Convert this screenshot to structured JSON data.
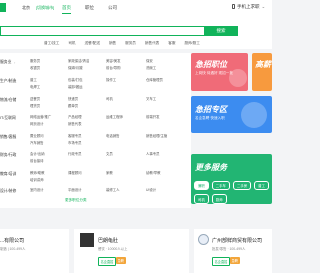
{
  "header": {
    "city": "北京",
    "switch_label": "[切换城市]",
    "nav": [
      "首页",
      "职位",
      "公司"
    ],
    "phone_label": "手机上求职"
  },
  "search": {
    "placeholder": "",
    "button_label": "搜索",
    "hot_tags": [
      "普工/技工",
      "司机",
      "送餐/配送",
      "销售",
      "服务员",
      "销售代表",
      "客服",
      "厨师/厨工"
    ]
  },
  "categories": {
    "rows": [
      {
        "label": "服务业",
        "items": [
          "服务员",
          "家政保洁/清洁",
          "美容/美发",
          "保安",
          "收银员",
          "保姆/月嫂",
          "前台/导购",
          "洗碗工"
        ]
      },
      {
        "label": "生产/制造",
        "items": [
          "普工",
          "包装/打包",
          "操作工",
          "仓库管理员",
          "电焊工",
          "装卸/搬运"
        ]
      },
      {
        "label": "物流/仓储",
        "items": [
          "送餐员",
          "快递员",
          "司机",
          "叉车工",
          "理货员",
          "跟单员"
        ]
      },
      {
        "label": "IT/互联网",
        "items": [
          "网络运营/推广",
          "产品经理",
          "运维工程师",
          "前端开发",
          "网页设计",
          "销售代表"
        ]
      },
      {
        "label": "销售/客服",
        "items": [
          "置业顾问",
          "客服专员",
          "电话销售",
          "销售经理/主管",
          "汽车销售",
          "市场专员"
        ]
      },
      {
        "label": "财务/行政",
        "items": [
          "会计/出纳",
          "行政专员",
          "文员",
          "人事专员",
          "前台接待"
        ]
      },
      {
        "label": "教育/培训",
        "items": [
          "教师/助教",
          "课程顾问",
          "家教",
          "幼教/早教",
          "培训讲师"
        ]
      },
      {
        "label": "设计/装修",
        "items": [
          "室内设计",
          "平面设计",
          "装修工人",
          "UI设计"
        ]
      }
    ],
    "more_label": "更多职位分类"
  },
  "promo": {
    "card1": {
      "title": "急招职位",
      "subtitle": "上岗快 待遇好 现招一批"
    },
    "card2": {
      "title": "高薪"
    },
    "card3": {
      "title": "急招专区",
      "subtitle": "名企急聘 快速入职"
    },
    "card4": {
      "title": "更多服务",
      "pills": [
        "兼职",
        "二手车",
        "二手房",
        "普工",
        "司机",
        "厨师"
      ]
    }
  },
  "listings": [
    {
      "name": "...有限公司",
      "sub": "制造 | 100-499人"
    },
    {
      "name": "巴朗龟肚",
      "sub": "餐饮 · 10000人以上",
      "badges": [
        "名企直招",
        "急聘"
      ]
    },
    {
      "name": "广州部鲜商贸有限公司",
      "sub": "批发/零售 · 100-499人",
      "badges": [
        "名企直招",
        "急聘"
      ]
    }
  ]
}
